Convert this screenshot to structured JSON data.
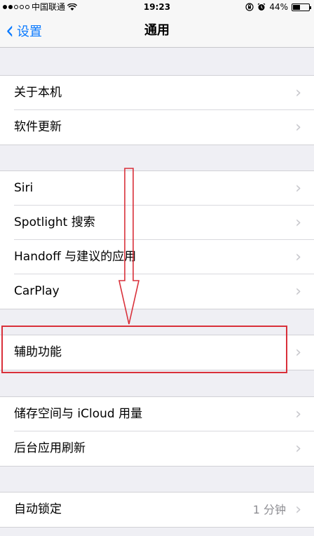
{
  "status_bar": {
    "carrier": "中国联通",
    "time": "19:23",
    "battery_percent": "44%",
    "battery_level": 0.44,
    "icons": [
      "signal-dots",
      "wifi-icon",
      "rotation-lock-icon",
      "alarm-icon",
      "battery-icon"
    ]
  },
  "nav": {
    "back_label": "设置",
    "title": "通用"
  },
  "groups": [
    {
      "items": [
        {
          "label": "关于本机"
        },
        {
          "label": "软件更新"
        }
      ]
    },
    {
      "items": [
        {
          "label": "Siri"
        },
        {
          "label": "Spotlight 搜索"
        },
        {
          "label": "Handoff 与建议的应用"
        },
        {
          "label": "CarPlay"
        }
      ]
    },
    {
      "items": [
        {
          "label": "辅助功能"
        }
      ]
    },
    {
      "items": [
        {
          "label": "储存空间与 iCloud 用量"
        },
        {
          "label": "后台应用刷新"
        }
      ]
    },
    {
      "items": [
        {
          "label": "自动锁定",
          "detail": "1 分钟"
        }
      ]
    }
  ],
  "annotation": {
    "color": "#d9303a",
    "highlighted_item": "辅助功能",
    "arrow_direction": "down"
  }
}
